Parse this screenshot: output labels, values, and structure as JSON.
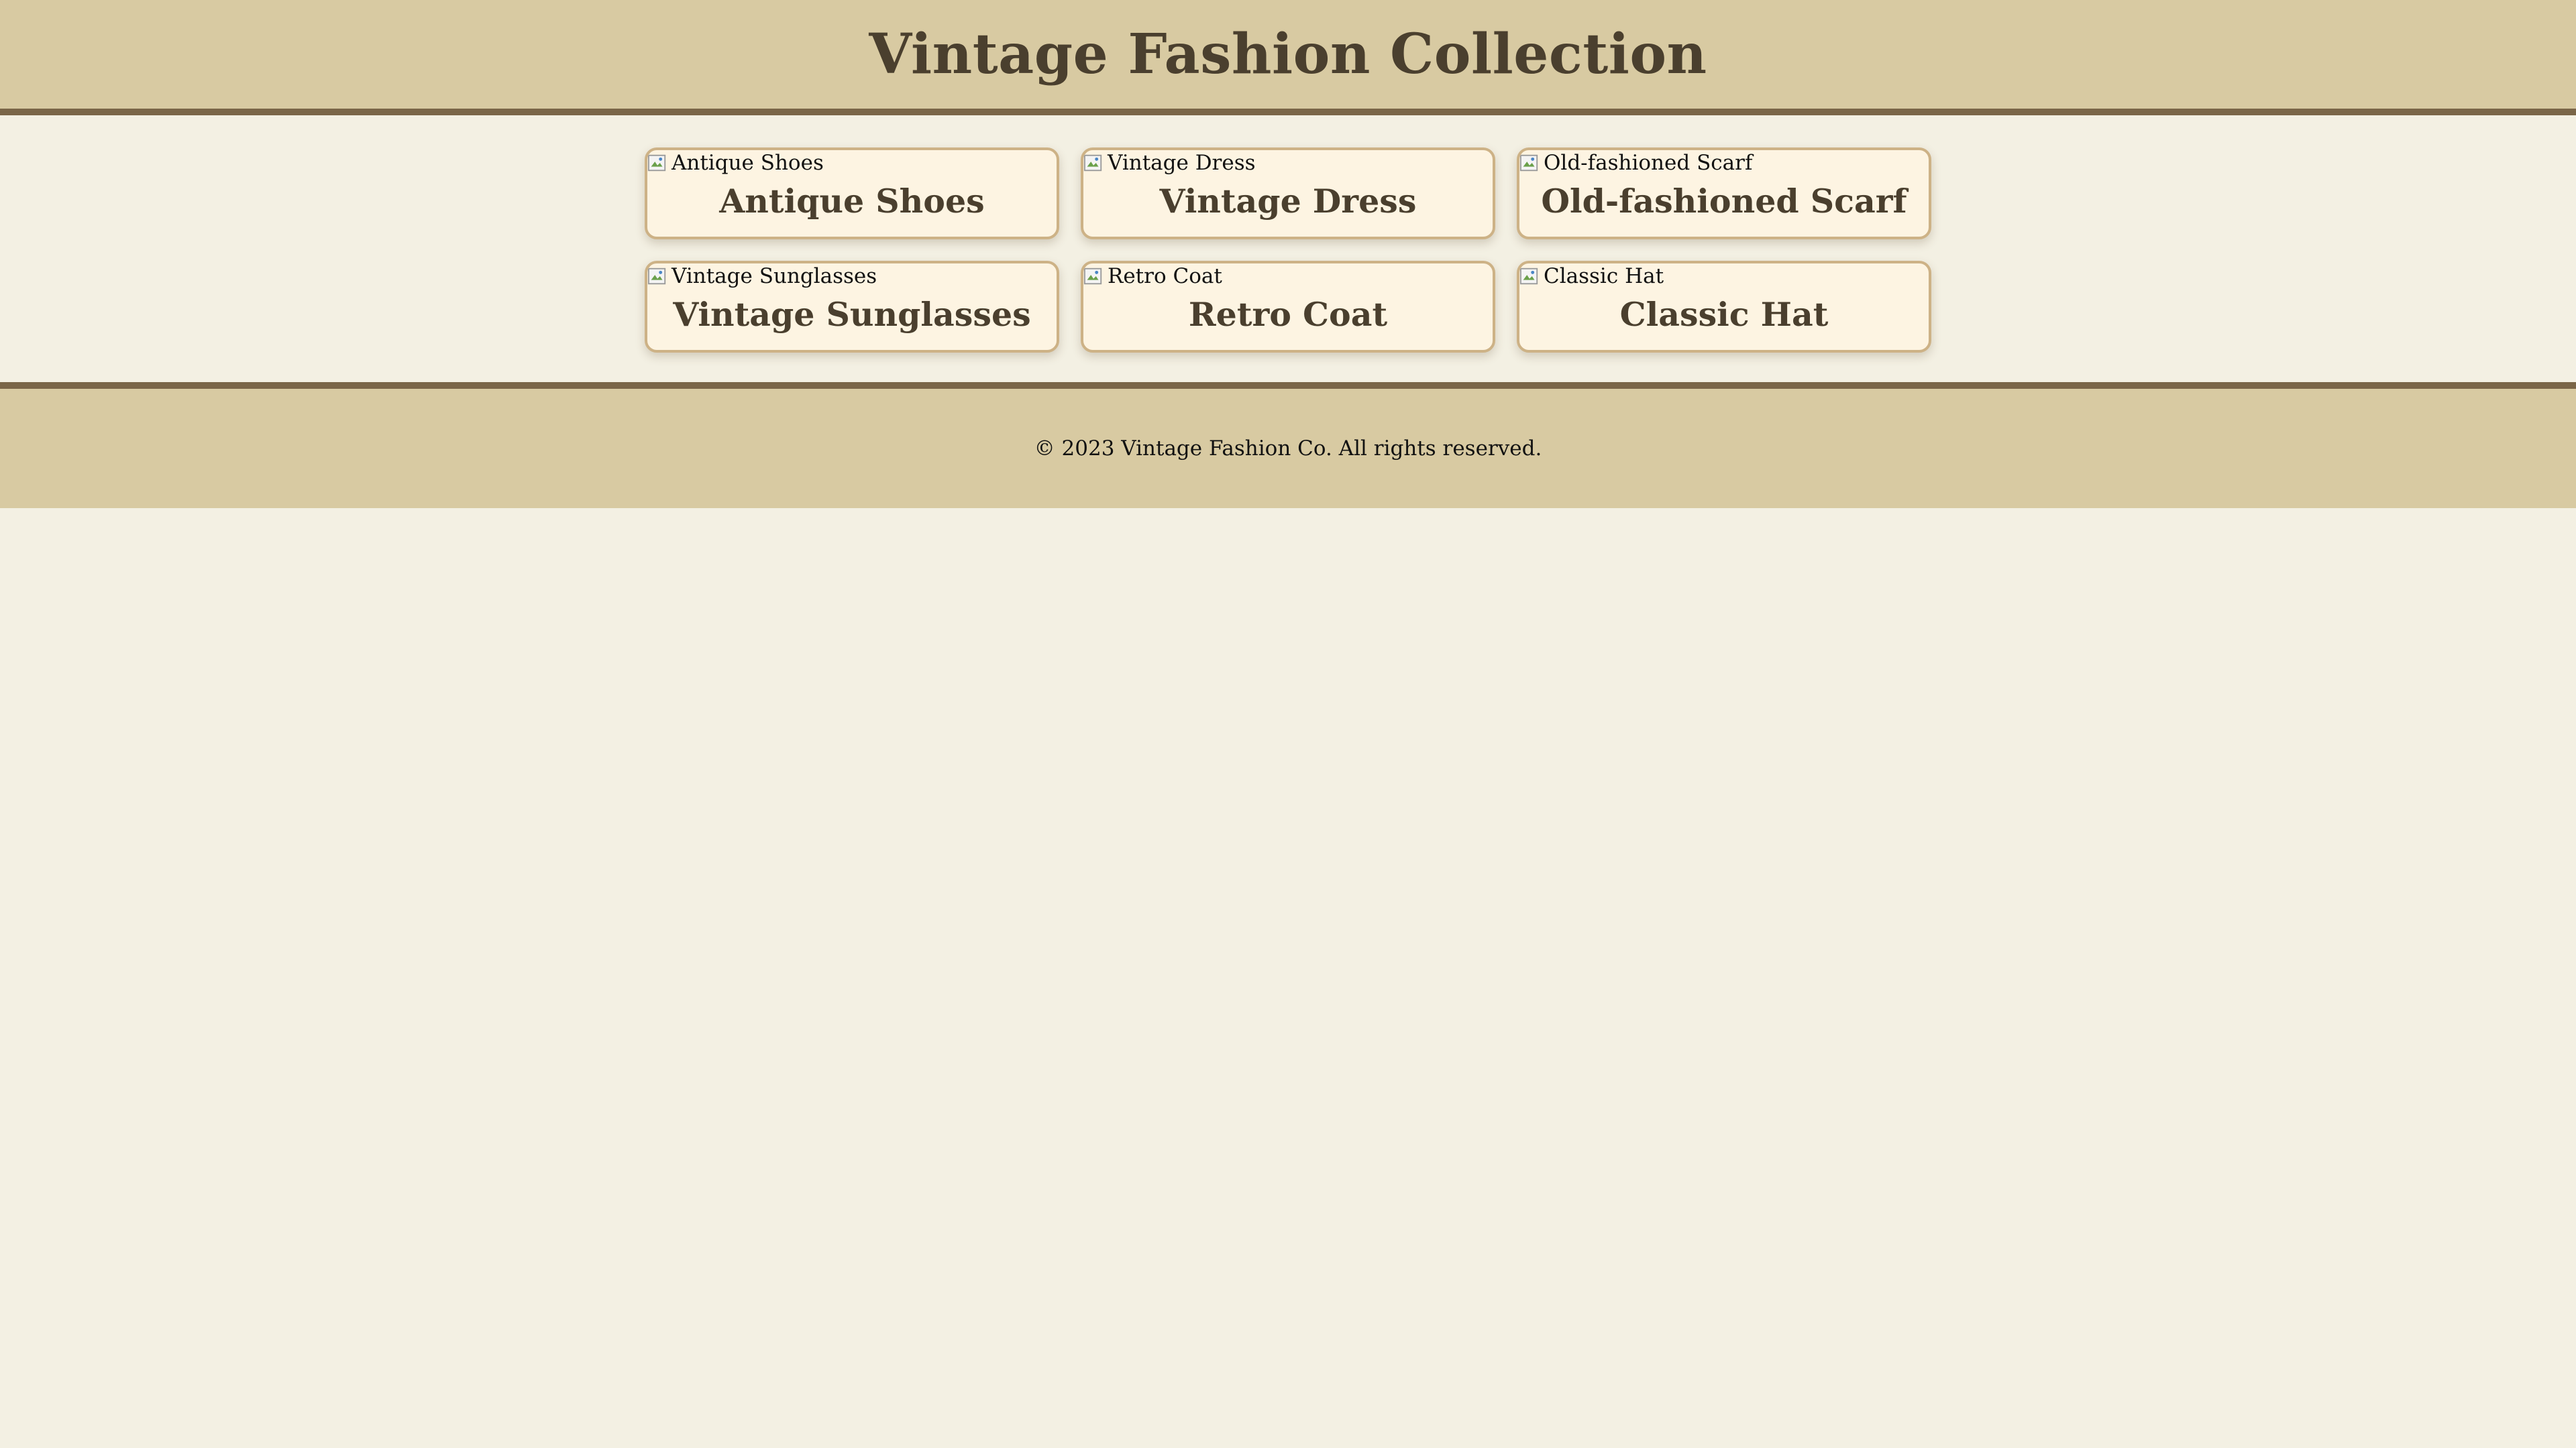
{
  "header": {
    "title": "Vintage Fashion Collection"
  },
  "products": [
    {
      "alt": "Antique Shoes",
      "name": "Antique Shoes"
    },
    {
      "alt": "Vintage Dress",
      "name": "Vintage Dress"
    },
    {
      "alt": "Old-fashioned Scarf",
      "name": "Old-fashioned Scarf"
    },
    {
      "alt": "Vintage Sunglasses",
      "name": "Vintage Sunglasses"
    },
    {
      "alt": "Retro Coat",
      "name": "Retro Coat"
    },
    {
      "alt": "Classic Hat",
      "name": "Classic Hat"
    }
  ],
  "footer": {
    "copyright": "© 2023 Vintage Fashion Co. All rights reserved."
  },
  "colors": {
    "header_bg": "#d8caa2",
    "border_accent": "#7a6648",
    "page_bg": "#f3f0e3",
    "card_bg": "#fdf4e2",
    "card_border": "#cdb286",
    "title_text": "#4a3f2e"
  },
  "icons": {
    "image_placeholder": "broken-image-icon"
  }
}
